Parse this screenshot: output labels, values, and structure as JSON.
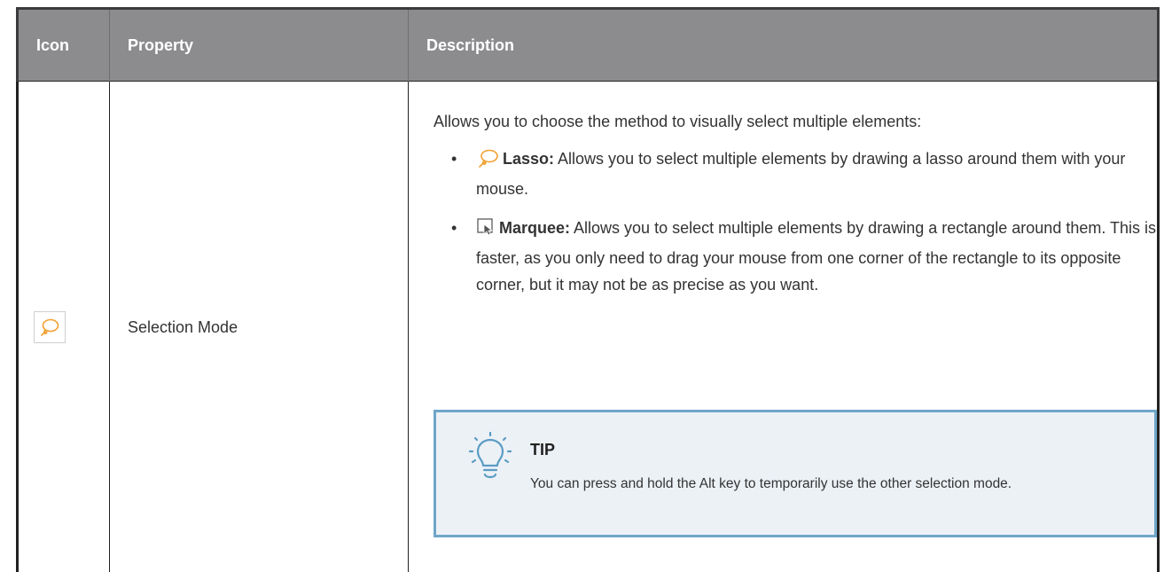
{
  "table": {
    "headers": {
      "icon": "Icon",
      "property": "Property",
      "description": "Description"
    },
    "row": {
      "icon": "lasso-icon",
      "property": "Selection Mode",
      "intro": "Allows you to choose the method to visually select multiple elements:",
      "modes": [
        {
          "icon": "lasso-icon",
          "term": "Lasso:",
          "text": "Allows you to select multiple elements by drawing a lasso around them with your mouse."
        },
        {
          "icon": "marquee-icon",
          "term": "Marquee:",
          "text": "Allows you to select multiple elements by drawing a rectangle around them. This is faster, as you only need to drag your mouse from one corner of the rectangle to its opposite corner, but it may not be as precise as you want."
        }
      ],
      "tip": {
        "icon": "lightbulb-icon",
        "title": "TIP",
        "text": "You can press and hold the Alt key to temporarily use the other selection mode."
      }
    }
  },
  "colors": {
    "header_bg": "#8c8c8f",
    "lasso_orange": "#f0a030",
    "tip_border": "#6fa6c8",
    "tip_bg": "#ecf1f6"
  }
}
